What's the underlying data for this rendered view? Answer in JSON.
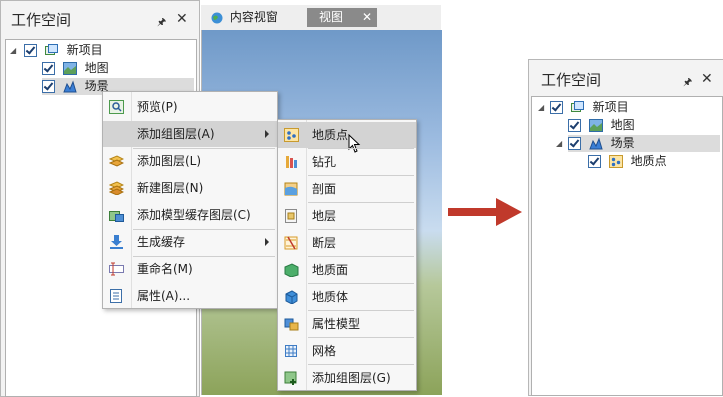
{
  "left_panel": {
    "title": "工作空间",
    "tree": [
      {
        "label": "新项目"
      },
      {
        "label": "地图"
      },
      {
        "label": "场景"
      }
    ]
  },
  "doc_tabs": [
    {
      "label": "内容视窗"
    },
    {
      "label": "视图"
    }
  ],
  "context_menu": {
    "items": [
      {
        "label": "预览(P)"
      },
      {
        "label": "添加组图层(A)"
      },
      {
        "label": "添加图层(L)"
      },
      {
        "label": "新建图层(N)"
      },
      {
        "label": "添加模型缓存图层(C)"
      },
      {
        "label": "生成缓存"
      },
      {
        "label": "重命名(M)"
      },
      {
        "label": "属性(A)..."
      }
    ]
  },
  "submenu": {
    "items": [
      {
        "label": "地质点"
      },
      {
        "label": "钻孔"
      },
      {
        "label": "剖面"
      },
      {
        "label": "地层"
      },
      {
        "label": "断层"
      },
      {
        "label": "地质面"
      },
      {
        "label": "地质体"
      },
      {
        "label": "属性模型"
      },
      {
        "label": "网格"
      },
      {
        "label": "添加组图层(G)"
      }
    ]
  },
  "right_panel": {
    "title": "工作空间",
    "tree": [
      {
        "label": "新项目"
      },
      {
        "label": "地图"
      },
      {
        "label": "场景"
      },
      {
        "label": "地质点"
      }
    ]
  },
  "colors": {
    "arrow": "#c0392b",
    "highlight": "#d3d3d3"
  }
}
